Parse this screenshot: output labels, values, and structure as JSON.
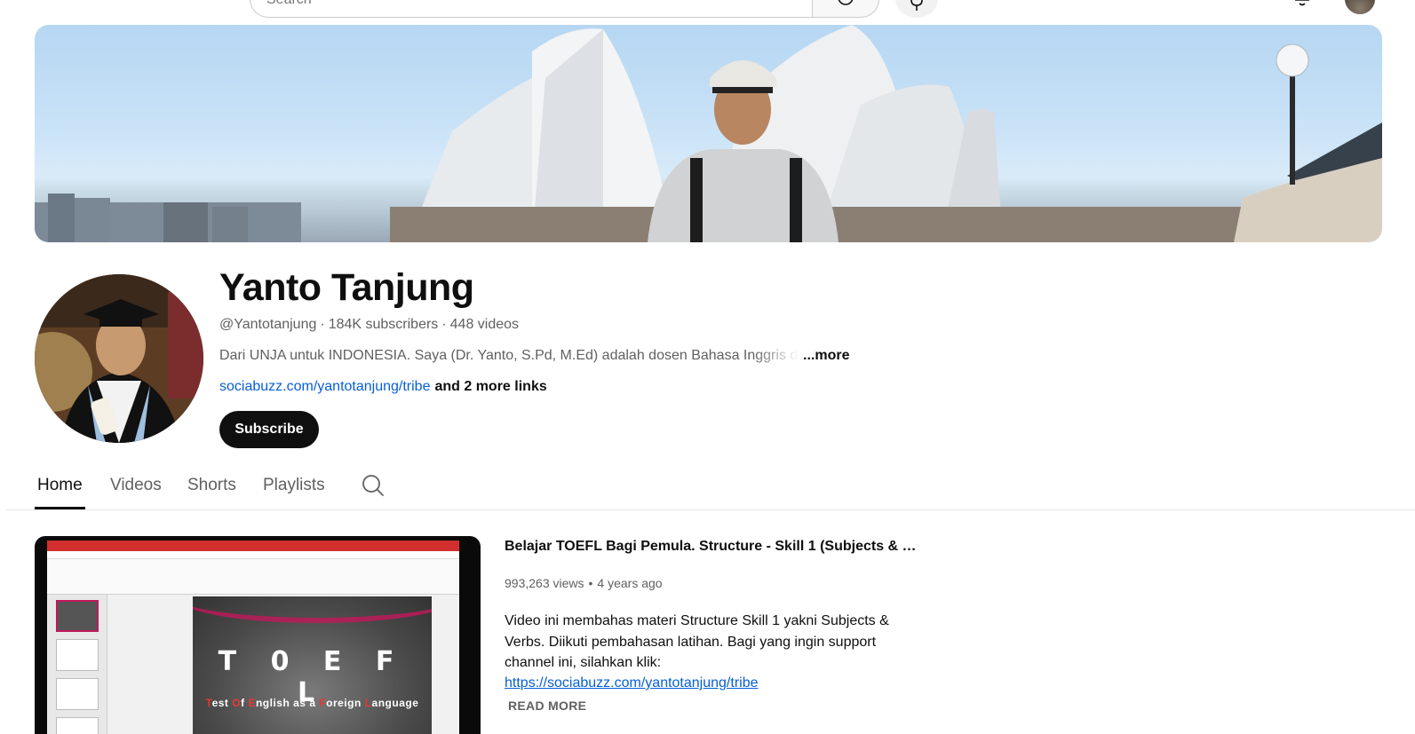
{
  "header": {
    "search_placeholder": "Search"
  },
  "channel": {
    "name": "Yanto Tanjung",
    "handle": "@Yantotanjung",
    "subscribers": "184K subscribers",
    "videos": "448 videos",
    "separator": "·",
    "description": "Dari UNJA untuk INDONESIA. Saya (Dr. Yanto, S.Pd, M.Ed) adalah dosen Bahasa Inggris d",
    "description_more": "...more",
    "link": "sociabuzz.com/yantotanjung/tribe",
    "more_links": "and 2 more links",
    "subscribe_label": "Subscribe"
  },
  "tabs": [
    {
      "label": "Home",
      "active": true
    },
    {
      "label": "Videos",
      "active": false
    },
    {
      "label": "Shorts",
      "active": false
    },
    {
      "label": "Playlists",
      "active": false
    }
  ],
  "featured_video": {
    "title": "Belajar TOEFL Bagi Pemula. Structure - Skill 1 (Subjects & Ver...",
    "views": "993,263 views",
    "dot": "•",
    "age": "4 years ago",
    "description": "Video ini membahas materi Structure Skill 1 yakni Subjects & Verbs. Diikuti pembahasan latihan. Bagi yang ingin support channel ini, silahkan klik:",
    "link": "https://sociabuzz.com/yantotanjung/tribe",
    "read_more": "READ MORE",
    "thumbnail": {
      "slide_title": "T 0 E F L",
      "sub_1a": "T",
      "sub_1b": "est ",
      "sub_2a": "O",
      "sub_2b": "f ",
      "sub_3a": "E",
      "sub_3b": "nglish  as  a ",
      "sub_4a": "F",
      "sub_4b": "oreign ",
      "sub_5a": "L",
      "sub_5b": "anguage"
    }
  },
  "colors": {
    "link": "#065fd4",
    "subscribe_bg": "#0f0f0f",
    "secondary_text": "#606060"
  }
}
